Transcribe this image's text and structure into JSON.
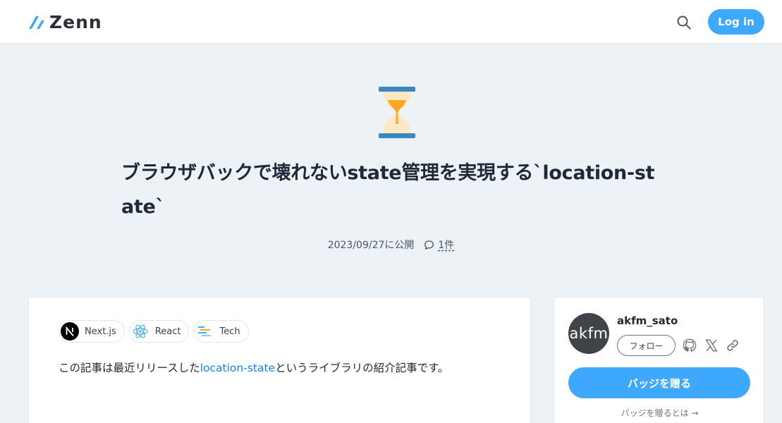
{
  "header": {
    "logo_text": "Zenn",
    "login_label": "Log in"
  },
  "article": {
    "emoji": "hourglass-icon",
    "title": "ブラウザバックで壊れないstate管理を実現する`location-state`",
    "published": "2023/09/27に公開",
    "comment_count": "1件",
    "topics": [
      {
        "label": "Next.js",
        "icon": "nextjs-icon"
      },
      {
        "label": "React",
        "icon": "react-icon"
      },
      {
        "label": "Tech",
        "icon": "tech-icon"
      }
    ],
    "intro_before": "この記事は最近リリースした",
    "intro_link": "location-state",
    "intro_after": "というライブラリの紹介記事です。"
  },
  "author": {
    "avatar_text": "akfm",
    "name": "akfm_sato",
    "follow_label": "フォロー",
    "badge_label": "バッジを贈る",
    "badge_help": "バッジを贈るとは →"
  },
  "colors": {
    "accent": "#3ea8ff",
    "link": "#0f83fd",
    "background": "#edf2f7"
  }
}
